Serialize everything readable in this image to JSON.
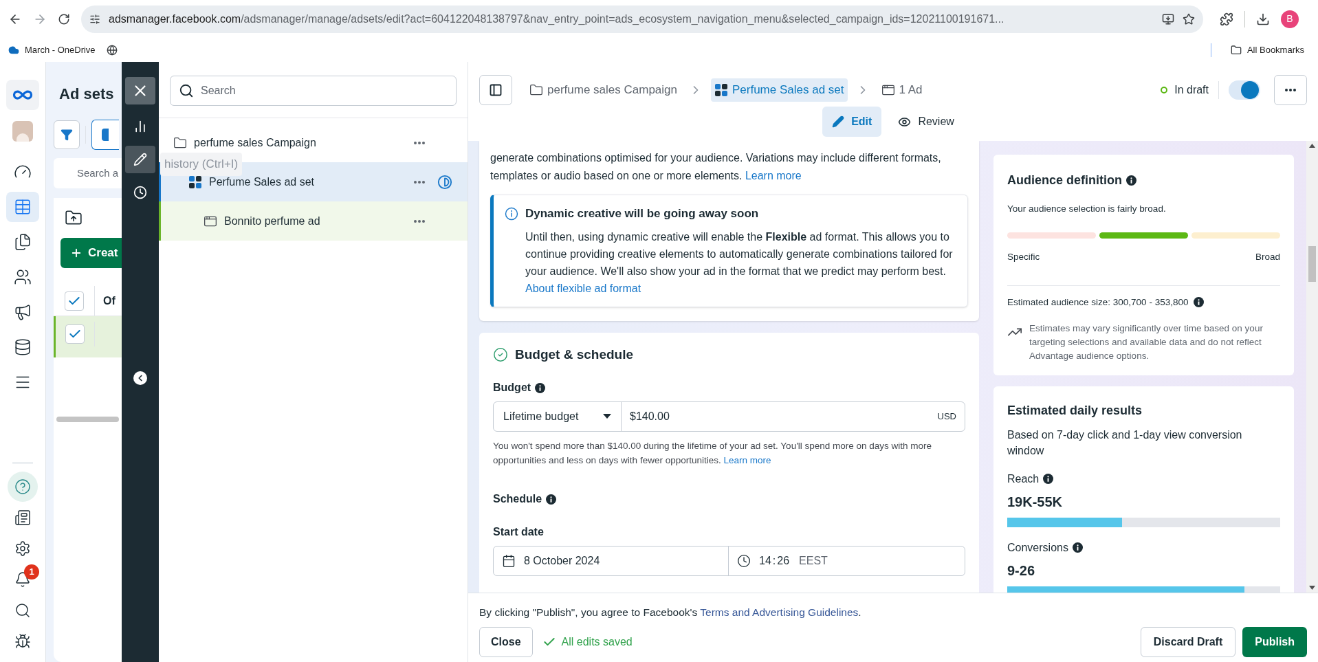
{
  "browser": {
    "host": "adsmanager.facebook.com",
    "path": "/adsmanager/manage/adsets/edit?act=604122048138797&nav_entry_point=ads_ecosystem_navigation_menu&selected_campaign_ids=12021100191671...",
    "profile": "B",
    "bookmarks": [
      {
        "label": "March - OneDrive"
      }
    ],
    "all_bookmarks": "All Bookmarks"
  },
  "nav_rail": {
    "items": [
      {
        "kind": "dashboard",
        "selected": false
      },
      {
        "kind": "table",
        "selected": true
      },
      {
        "kind": "pages",
        "selected": false
      },
      {
        "kind": "audiences",
        "selected": false
      },
      {
        "kind": "campaigns",
        "selected": false
      },
      {
        "kind": "billing",
        "selected": false
      },
      {
        "kind": "menu",
        "selected": false
      }
    ],
    "bottom_items": [
      {
        "kind": "help"
      },
      {
        "kind": "news"
      },
      {
        "kind": "settings"
      },
      {
        "kind": "notifications",
        "badge": "1"
      },
      {
        "kind": "search"
      },
      {
        "kind": "debug"
      }
    ]
  },
  "ad_sets_panel": {
    "title": "Ad sets",
    "search": {
      "placeholder": "Search a"
    },
    "create": "Creat",
    "column_1": "Of",
    "header_checked": true,
    "rows": [
      {
        "checked": true
      }
    ]
  },
  "tooltips": [
    {
      "text": "history (Ctrl+I)"
    }
  ],
  "tool_rail": {
    "tools": [
      {
        "kind": "insights",
        "selected": false
      },
      {
        "kind": "edit",
        "selected": true
      },
      {
        "kind": "history",
        "selected": false
      }
    ]
  },
  "tree": {
    "search": {
      "placeholder": "Search"
    },
    "items": [
      {
        "kind": "campaign",
        "label": "perfume sales Campaign",
        "selected": false,
        "draft": false,
        "children": [
          {
            "kind": "adset",
            "label": "Perfume Sales ad set",
            "selected": true,
            "draft": true,
            "children": [
              {
                "kind": "ad",
                "label": "Bonnito perfume ad",
                "selected": false,
                "draft": false
              }
            ]
          }
        ]
      }
    ]
  },
  "header": {
    "breadcrumbs": [
      {
        "kind": "campaign",
        "label": "perfume sales Campaign",
        "selected": false
      },
      {
        "kind": "adset",
        "label": "Perfume Sales ad set",
        "selected": true
      },
      {
        "kind": "ad",
        "label": "1 Ad",
        "selected": false
      }
    ],
    "status": "In draft",
    "toggle_on": true,
    "tabs": [
      {
        "kind": "edit",
        "label": "Edit",
        "selected": true
      },
      {
        "kind": "review",
        "label": "Review",
        "selected": false
      }
    ]
  },
  "creative_card": {
    "text": "generate combinations optimised for your audience. Variations may include different formats, templates or audio based on one or more elements.",
    "link": "Learn more",
    "notice": {
      "title": "Dynamic creative will be going away soon",
      "body": "Until then, using dynamic creative will enable the **Flexible** ad format. This allows you to continue providing creative elements to automatically generate combinations tailored for your audience. We'll also show your ad in the format that we predict may perform best.",
      "link": "About flexible ad format"
    }
  },
  "budget_card": {
    "title": "Budget & schedule",
    "complete": true,
    "budget_label": "Budget",
    "budget_type": "Lifetime budget",
    "amount": "$140.00",
    "currency": "USD",
    "help": "You won't spend more than $140.00 during the lifetime of your ad set. You'll spend more on days with more opportunities and less on days with fewer opportunities.",
    "help_link": "Learn more",
    "schedule_label": "Schedule",
    "start_date_label": "Start date",
    "start_date": "8 October 2024",
    "hour": "14",
    "separator": ":",
    "minute": "26",
    "timezone": "EEST"
  },
  "audience_card": {
    "title": "Audience definition",
    "summary": "Your audience selection is fairly broad.",
    "segments": [
      {
        "color": "#fde3e0"
      },
      {
        "color": "#5cb814"
      },
      {
        "color": "#fdefcf"
      }
    ],
    "low_label": "Specific",
    "high_label": "Broad",
    "size": "Estimated audience size: 300,700 - 353,800",
    "note": "Estimates may vary significantly over time based on your targeting selections and available data and do not reflect Advantage audience options."
  },
  "results_card": {
    "title": "Estimated daily results",
    "subtitle": "Based on 7-day click and 1-day view conversion window",
    "metrics": [
      {
        "label": "Reach",
        "value": "19K-55K",
        "level": 0.42
      },
      {
        "label": "Conversions",
        "value": "9-26",
        "level": 0.87
      }
    ]
  },
  "footer": {
    "consent_prefix": "By clicking \"Publish\", you agree to Facebook's",
    "consent_link": "Terms and Advertising Guidelines",
    "consent_suffix": ".",
    "close": "Close",
    "saved": "All edits saved",
    "discard": "Discard Draft",
    "publish": "Publish"
  }
}
